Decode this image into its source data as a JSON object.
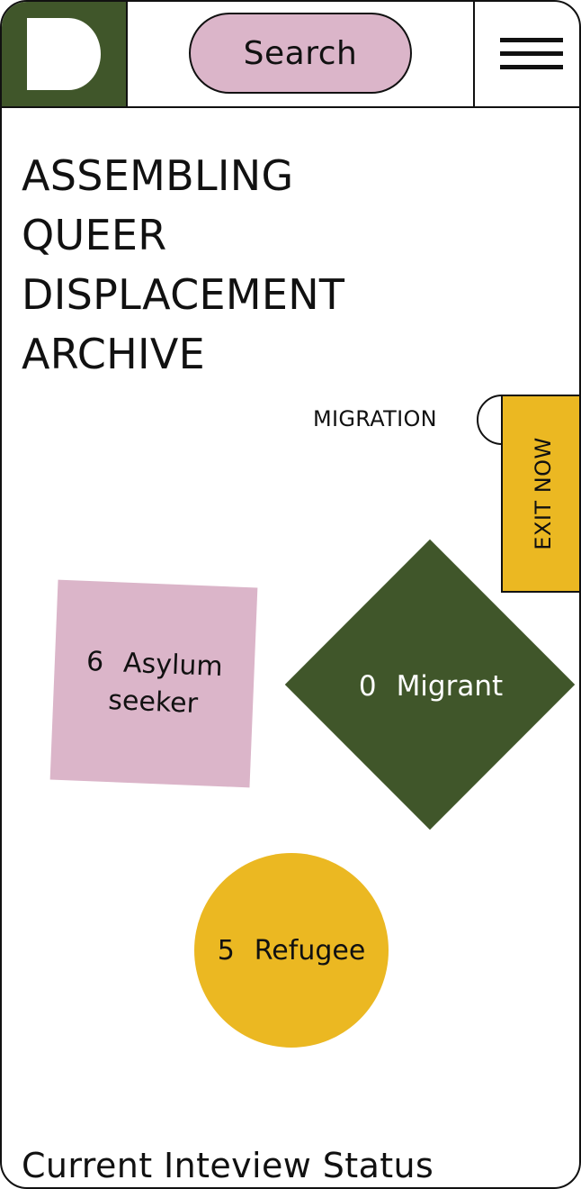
{
  "header": {
    "search_label": "Search"
  },
  "title": {
    "lines": [
      "ASSEMBLING",
      "QUEER",
      "DISPLACEMENT",
      "ARCHIVE"
    ]
  },
  "filter": {
    "label": "MIGRATION"
  },
  "exit_button": {
    "label": "EXIT NOW"
  },
  "categories": [
    {
      "count": "6",
      "line1": "Asylum",
      "line2": "seeker"
    },
    {
      "count": "0",
      "name": "Migrant"
    },
    {
      "count": "5",
      "name": "Refugee"
    }
  ],
  "status": {
    "title": "Current Inteview Status"
  },
  "colors": {
    "green": "#40562a",
    "pink": "#dbb5c9",
    "yellow": "#ebb822"
  },
  "icons": [
    "logo-mark-icon",
    "hamburger-menu-icon"
  ]
}
